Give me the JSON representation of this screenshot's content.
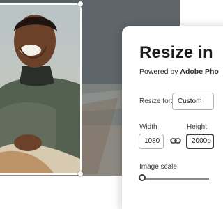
{
  "panel": {
    "title": "Resize in",
    "subtitle_prefix": "Powered by ",
    "subtitle_brand": "Adobe Pho",
    "resize_for_label": "Resize for:",
    "resize_for_value": "Custom",
    "width_label": "Width",
    "width_value": "1080",
    "height_label": "Height",
    "height_value": "2000p",
    "image_scale_label": "Image scale",
    "image_scale_level": 0
  },
  "icons": {
    "link": "link-icon"
  },
  "colors": {
    "panel_bg": "#ffffff",
    "field_border": "#b3b3b3",
    "active_border": "#3a3a3a"
  }
}
